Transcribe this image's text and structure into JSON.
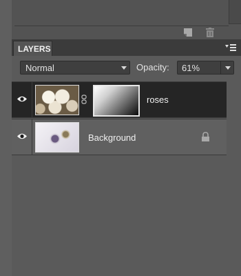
{
  "panel": {
    "tab_label": "LAYERS"
  },
  "blend_mode": {
    "selected": "Normal"
  },
  "opacity": {
    "label": "Opacity:",
    "value": "61%"
  },
  "layers": [
    {
      "name": "roses",
      "selected": true,
      "visible": true,
      "has_mask": true,
      "locked": false
    },
    {
      "name": "Background",
      "selected": false,
      "visible": true,
      "has_mask": false,
      "locked": true
    }
  ],
  "icons": {
    "new_layer": "new-layer-icon",
    "delete": "trash-icon",
    "panel_menu": "panel-menu-icon",
    "visibility": "eye-icon",
    "link": "link-icon",
    "lock": "lock-icon"
  },
  "colors": {
    "panel_bg": "#5a5a5a",
    "selected_row": "#252525",
    "tab_bg": "#555555"
  }
}
